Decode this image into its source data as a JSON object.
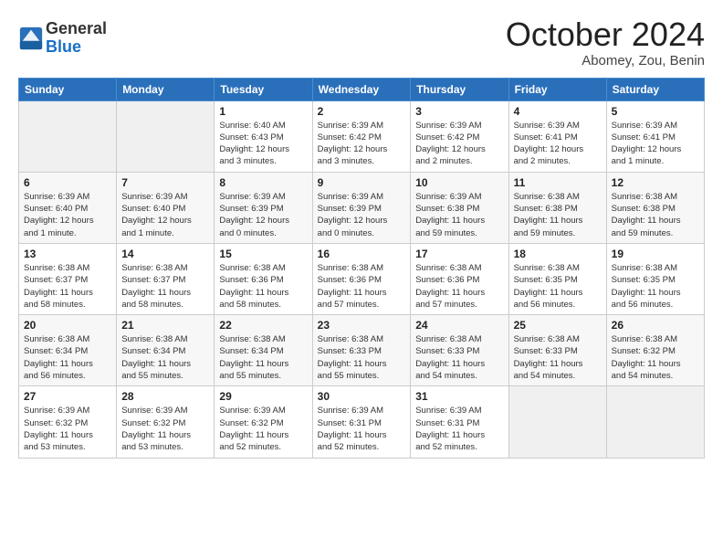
{
  "logo": {
    "line1": "General",
    "line2": "Blue"
  },
  "title": "October 2024",
  "location": "Abomey, Zou, Benin",
  "weekdays": [
    "Sunday",
    "Monday",
    "Tuesday",
    "Wednesday",
    "Thursday",
    "Friday",
    "Saturday"
  ],
  "weeks": [
    [
      {
        "day": "",
        "info": ""
      },
      {
        "day": "",
        "info": ""
      },
      {
        "day": "1",
        "info": "Sunrise: 6:40 AM\nSunset: 6:43 PM\nDaylight: 12 hours\nand 3 minutes."
      },
      {
        "day": "2",
        "info": "Sunrise: 6:39 AM\nSunset: 6:42 PM\nDaylight: 12 hours\nand 3 minutes."
      },
      {
        "day": "3",
        "info": "Sunrise: 6:39 AM\nSunset: 6:42 PM\nDaylight: 12 hours\nand 2 minutes."
      },
      {
        "day": "4",
        "info": "Sunrise: 6:39 AM\nSunset: 6:41 PM\nDaylight: 12 hours\nand 2 minutes."
      },
      {
        "day": "5",
        "info": "Sunrise: 6:39 AM\nSunset: 6:41 PM\nDaylight: 12 hours\nand 1 minute."
      }
    ],
    [
      {
        "day": "6",
        "info": "Sunrise: 6:39 AM\nSunset: 6:40 PM\nDaylight: 12 hours\nand 1 minute."
      },
      {
        "day": "7",
        "info": "Sunrise: 6:39 AM\nSunset: 6:40 PM\nDaylight: 12 hours\nand 1 minute."
      },
      {
        "day": "8",
        "info": "Sunrise: 6:39 AM\nSunset: 6:39 PM\nDaylight: 12 hours\nand 0 minutes."
      },
      {
        "day": "9",
        "info": "Sunrise: 6:39 AM\nSunset: 6:39 PM\nDaylight: 12 hours\nand 0 minutes."
      },
      {
        "day": "10",
        "info": "Sunrise: 6:39 AM\nSunset: 6:38 PM\nDaylight: 11 hours\nand 59 minutes."
      },
      {
        "day": "11",
        "info": "Sunrise: 6:38 AM\nSunset: 6:38 PM\nDaylight: 11 hours\nand 59 minutes."
      },
      {
        "day": "12",
        "info": "Sunrise: 6:38 AM\nSunset: 6:38 PM\nDaylight: 11 hours\nand 59 minutes."
      }
    ],
    [
      {
        "day": "13",
        "info": "Sunrise: 6:38 AM\nSunset: 6:37 PM\nDaylight: 11 hours\nand 58 minutes."
      },
      {
        "day": "14",
        "info": "Sunrise: 6:38 AM\nSunset: 6:37 PM\nDaylight: 11 hours\nand 58 minutes."
      },
      {
        "day": "15",
        "info": "Sunrise: 6:38 AM\nSunset: 6:36 PM\nDaylight: 11 hours\nand 58 minutes."
      },
      {
        "day": "16",
        "info": "Sunrise: 6:38 AM\nSunset: 6:36 PM\nDaylight: 11 hours\nand 57 minutes."
      },
      {
        "day": "17",
        "info": "Sunrise: 6:38 AM\nSunset: 6:36 PM\nDaylight: 11 hours\nand 57 minutes."
      },
      {
        "day": "18",
        "info": "Sunrise: 6:38 AM\nSunset: 6:35 PM\nDaylight: 11 hours\nand 56 minutes."
      },
      {
        "day": "19",
        "info": "Sunrise: 6:38 AM\nSunset: 6:35 PM\nDaylight: 11 hours\nand 56 minutes."
      }
    ],
    [
      {
        "day": "20",
        "info": "Sunrise: 6:38 AM\nSunset: 6:34 PM\nDaylight: 11 hours\nand 56 minutes."
      },
      {
        "day": "21",
        "info": "Sunrise: 6:38 AM\nSunset: 6:34 PM\nDaylight: 11 hours\nand 55 minutes."
      },
      {
        "day": "22",
        "info": "Sunrise: 6:38 AM\nSunset: 6:34 PM\nDaylight: 11 hours\nand 55 minutes."
      },
      {
        "day": "23",
        "info": "Sunrise: 6:38 AM\nSunset: 6:33 PM\nDaylight: 11 hours\nand 55 minutes."
      },
      {
        "day": "24",
        "info": "Sunrise: 6:38 AM\nSunset: 6:33 PM\nDaylight: 11 hours\nand 54 minutes."
      },
      {
        "day": "25",
        "info": "Sunrise: 6:38 AM\nSunset: 6:33 PM\nDaylight: 11 hours\nand 54 minutes."
      },
      {
        "day": "26",
        "info": "Sunrise: 6:38 AM\nSunset: 6:32 PM\nDaylight: 11 hours\nand 54 minutes."
      }
    ],
    [
      {
        "day": "27",
        "info": "Sunrise: 6:39 AM\nSunset: 6:32 PM\nDaylight: 11 hours\nand 53 minutes."
      },
      {
        "day": "28",
        "info": "Sunrise: 6:39 AM\nSunset: 6:32 PM\nDaylight: 11 hours\nand 53 minutes."
      },
      {
        "day": "29",
        "info": "Sunrise: 6:39 AM\nSunset: 6:32 PM\nDaylight: 11 hours\nand 52 minutes."
      },
      {
        "day": "30",
        "info": "Sunrise: 6:39 AM\nSunset: 6:31 PM\nDaylight: 11 hours\nand 52 minutes."
      },
      {
        "day": "31",
        "info": "Sunrise: 6:39 AM\nSunset: 6:31 PM\nDaylight: 11 hours\nand 52 minutes."
      },
      {
        "day": "",
        "info": ""
      },
      {
        "day": "",
        "info": ""
      }
    ]
  ]
}
